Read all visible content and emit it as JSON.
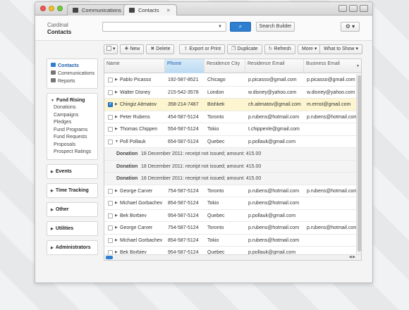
{
  "tabs": [
    {
      "label": "Communications"
    },
    {
      "label": "Contacts"
    }
  ],
  "brand": {
    "line1": "Cardinal",
    "line2": "Contacts"
  },
  "search": {
    "placeholder": "",
    "button_icon": "search-icon",
    "builder_label": "Search Builder"
  },
  "toolbar": {
    "new_label": "New",
    "delete_label": "Delete",
    "export_label": "Export or Print",
    "duplicate_label": "Duplicate",
    "refresh_label": "Refresh",
    "more_label": "More",
    "what_to_show_label": "What to Show"
  },
  "sidebar": {
    "main": [
      "Contacts",
      "Communications",
      "Reports"
    ],
    "fund_rising": {
      "title": "Fund Rising",
      "items": [
        "Donations",
        "Campaigns",
        "Pledges",
        "Fund Programs",
        "Fund Requests",
        "Proposals",
        "Prospect Ratings"
      ]
    },
    "sections": [
      "Events",
      "Time Tracking",
      "Other",
      "Utilities",
      "Administrators"
    ]
  },
  "grid": {
    "columns": [
      "Name",
      "Phone",
      "Residence City",
      "Residence Email",
      "Business Email"
    ],
    "rows": [
      {
        "name": "Pablo Picasso",
        "phone": "192-587-8521",
        "city": "Chicago",
        "email": "p.picasso@gmail.com",
        "business": "p.picasso@gmail.com"
      },
      {
        "name": "Walter Disney",
        "phone": "215-542-3578",
        "city": "London",
        "email": "w.disney@yahoo.com",
        "business": "w.disney@yahoo.com"
      },
      {
        "name": "Chingiz Aitmatov",
        "phone": "358-214-7487",
        "city": "Bishkek",
        "email": "ch.aitmatov@gmail.com",
        "business": "m.ernst@gmail.com",
        "selected": true
      },
      {
        "name": "Peter Rubens",
        "phone": "454-587-5124",
        "city": "Toronto",
        "email": "p.rubens@hotmail.com",
        "business": "p.rubens@hotmail.com"
      },
      {
        "name": "Thomas Chippen",
        "phone": "554-587-5124",
        "city": "Tokio",
        "email": "t.chippenle@gmail.com",
        "business": ""
      },
      {
        "name": "Poll Pollauk",
        "phone": "654-587-5124",
        "city": "Quebec",
        "email": "p.pollauk@gmail.com",
        "business": "",
        "expanded": true
      }
    ],
    "details": [
      {
        "label": "Donation",
        "text": "18 December 2011: receipt not issued; amount: 415.00"
      },
      {
        "label": "Donation",
        "text": "18 December 2011: receipt not issued; amount: 415.00"
      },
      {
        "label": "Donation",
        "text": "18 December 2011: receipt not issued; amount: 415.00"
      }
    ],
    "rows2": [
      {
        "name": "George Carver",
        "phone": "754-587-5124",
        "city": "Toronto",
        "email": "p.rubens@hotmail.com",
        "business": "p.rubens@hotmail.com"
      },
      {
        "name": "Michael Gorbachev",
        "phone": "854-587-5124",
        "city": "Tokio",
        "email": "p.rubens@hotmail.com",
        "business": ""
      },
      {
        "name": "Bek Borbiev",
        "phone": "954-587-5124",
        "city": "Quebec",
        "email": "p.pollauk@gmail.com",
        "business": ""
      },
      {
        "name": "George Carver",
        "phone": "754-587-5124",
        "city": "Toronto",
        "email": "p.rubens@hotmail.com",
        "business": "p.rubens@hotmail.com"
      },
      {
        "name": "Michael Gorbachev",
        "phone": "854-587-5124",
        "city": "Tokio",
        "email": "p.rubens@hotmail.com",
        "business": ""
      },
      {
        "name": "Bek Borbiev",
        "phone": "954-587-5124",
        "city": "Quebec",
        "email": "p.pollauk@gmail.com",
        "business": ""
      }
    ]
  }
}
